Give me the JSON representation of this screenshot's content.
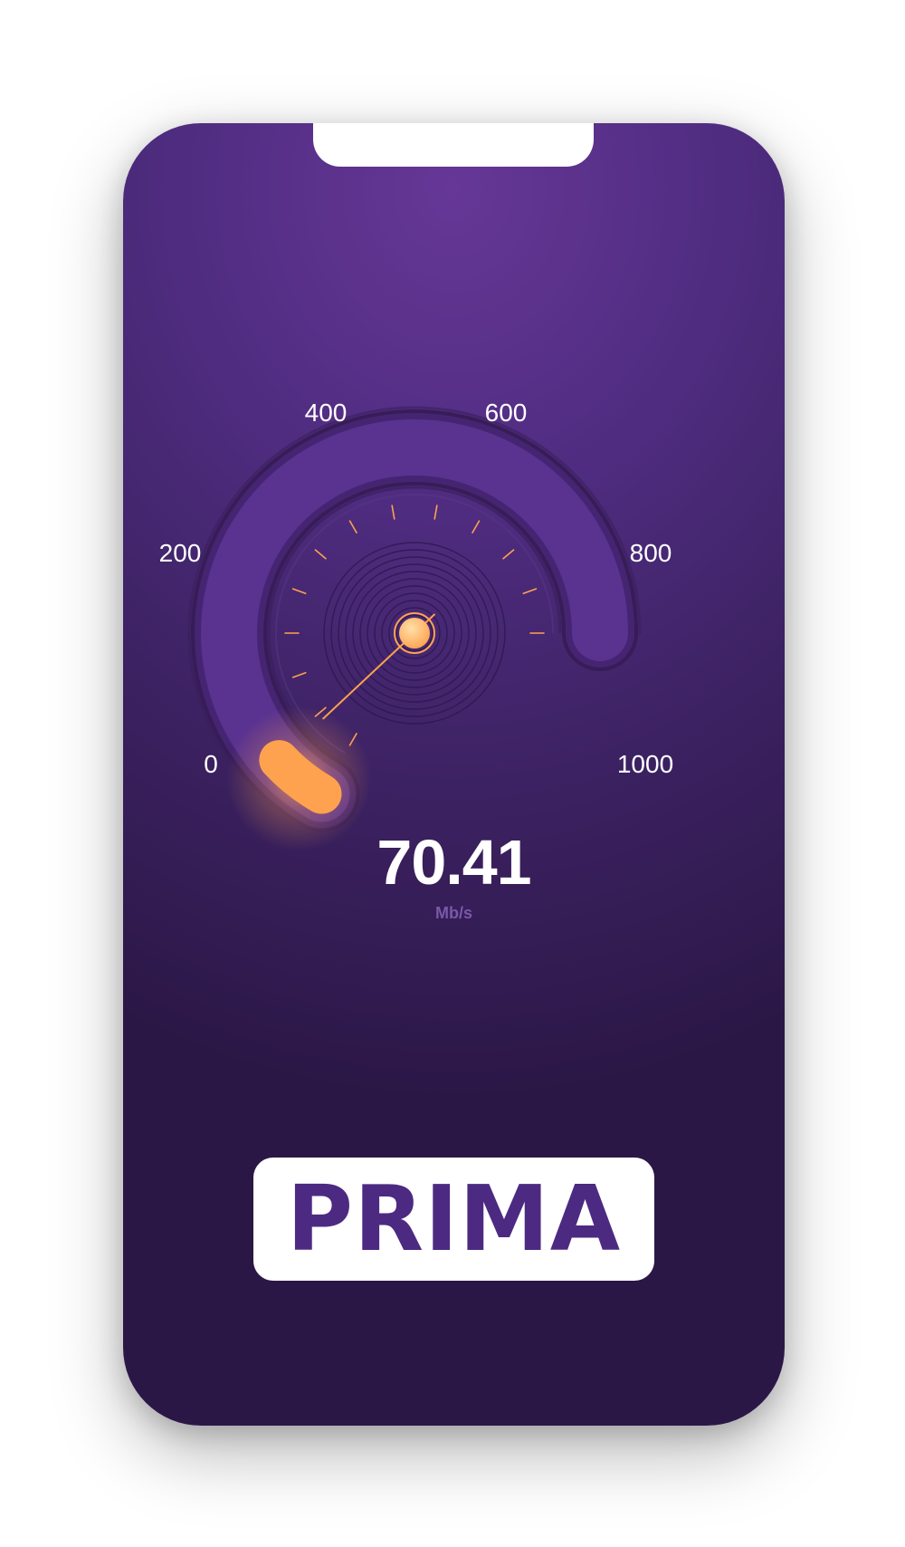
{
  "gauge": {
    "min": 0,
    "max": 1000,
    "current_value": 70.41,
    "scale_labels": [
      "0",
      "200",
      "400",
      "600",
      "800",
      "1000"
    ]
  },
  "readout": {
    "value": "70.41",
    "unit": "Mb/s"
  },
  "brand": {
    "logo_text": "PRIMA"
  },
  "colors": {
    "accent": "#ffa24f",
    "background_top": "#663797",
    "background_bottom": "#2b1746",
    "track": "#5a3290",
    "logo_text": "#4c2a82"
  }
}
